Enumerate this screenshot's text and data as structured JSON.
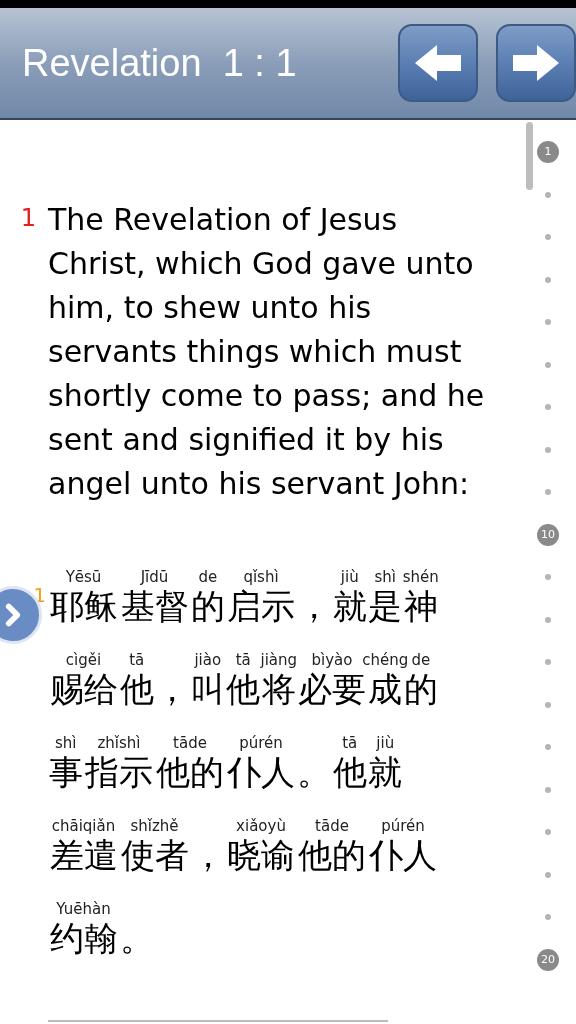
{
  "header": {
    "title": "Revelation  1 : 1",
    "buttons": [
      {
        "kind": "prev"
      },
      {
        "kind": "next"
      }
    ]
  },
  "verses": [
    {
      "kind": "english",
      "number": "1",
      "text": "The Revelation of Jesus Christ, which God gave unto him, to shew unto his servants things which must shortly come to pass; and he sent and signified it by his angel unto his servant John:"
    },
    {
      "kind": "pinyin",
      "number": "1",
      "lines": [
        [
          {
            "hanzi": "耶稣",
            "pinyin": "Yēsū"
          },
          {
            "hanzi": "基督",
            "pinyin": "Jīdū"
          },
          {
            "hanzi": "的",
            "pinyin": "de"
          },
          {
            "hanzi": "启示",
            "pinyin": "qǐshì"
          },
          {
            "hanzi": "，"
          },
          {
            "hanzi": "就",
            "pinyin": "jiù"
          },
          {
            "hanzi": "是",
            "pinyin": "shì"
          },
          {
            "hanzi": "神",
            "pinyin": "shén"
          }
        ],
        [
          {
            "hanzi": "赐给",
            "pinyin": "cìgěi"
          },
          {
            "hanzi": "他",
            "pinyin": "tā"
          },
          {
            "hanzi": "，"
          },
          {
            "hanzi": "叫",
            "pinyin": "jiào"
          },
          {
            "hanzi": "他",
            "pinyin": "tā"
          },
          {
            "hanzi": "将",
            "pinyin": "jiàng"
          },
          {
            "hanzi": "必要",
            "pinyin": "bìyào"
          },
          {
            "hanzi": "成",
            "pinyin": "chéng"
          },
          {
            "hanzi": "的",
            "pinyin": "de"
          }
        ],
        [
          {
            "hanzi": "事",
            "pinyin": "shì"
          },
          {
            "hanzi": "指示",
            "pinyin": "zhǐshì"
          },
          {
            "hanzi": "他的",
            "pinyin": "tāde"
          },
          {
            "hanzi": "仆人",
            "pinyin": "púrén"
          },
          {
            "hanzi": "。"
          },
          {
            "hanzi": "他",
            "pinyin": "tā"
          },
          {
            "hanzi": "就",
            "pinyin": "jiù"
          }
        ],
        [
          {
            "hanzi": "差遣",
            "pinyin": "chāiqiǎn"
          },
          {
            "hanzi": "使者",
            "pinyin": "shǐzhě"
          },
          {
            "hanzi": "，"
          },
          {
            "hanzi": "晓谕",
            "pinyin": "xiǎoyù"
          },
          {
            "hanzi": "他的",
            "pinyin": "tāde"
          },
          {
            "hanzi": "仆人",
            "pinyin": "púrén"
          }
        ],
        [
          {
            "hanzi": "约翰",
            "pinyin": "Yuēhàn"
          },
          {
            "hanzi": "。"
          }
        ]
      ]
    }
  ],
  "verse_index": [
    {
      "kind": "number",
      "label": "1"
    },
    {
      "kind": "dot"
    },
    {
      "kind": "dot"
    },
    {
      "kind": "dot"
    },
    {
      "kind": "dot"
    },
    {
      "kind": "dot"
    },
    {
      "kind": "dot"
    },
    {
      "kind": "dot"
    },
    {
      "kind": "dot"
    },
    {
      "kind": "number",
      "label": "10"
    },
    {
      "kind": "dot"
    },
    {
      "kind": "dot"
    },
    {
      "kind": "dot"
    },
    {
      "kind": "dot"
    },
    {
      "kind": "dot"
    },
    {
      "kind": "dot"
    },
    {
      "kind": "dot"
    },
    {
      "kind": "dot"
    },
    {
      "kind": "dot"
    },
    {
      "kind": "number",
      "label": "20"
    }
  ]
}
